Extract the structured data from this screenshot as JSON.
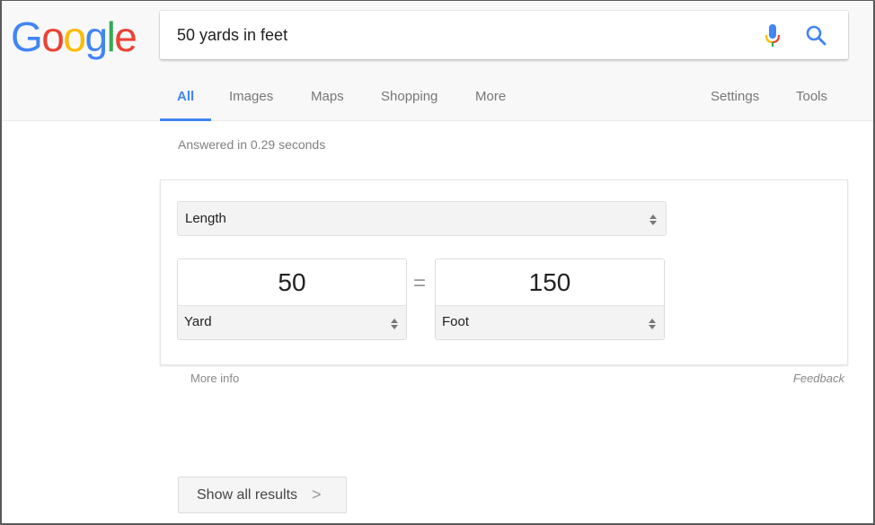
{
  "logo": {
    "text": "Google",
    "letters": [
      {
        "char": "G",
        "color": "#4285f4"
      },
      {
        "char": "o",
        "color": "#ea4335"
      },
      {
        "char": "o",
        "color": "#fbbc05"
      },
      {
        "char": "g",
        "color": "#4285f4"
      },
      {
        "char": "l",
        "color": "#34a853"
      },
      {
        "char": "e",
        "color": "#ea4335"
      }
    ]
  },
  "search": {
    "query": "50 yards in feet",
    "mic_icon": "microphone-icon",
    "search_icon": "magnifier-icon"
  },
  "tabs": {
    "items": [
      {
        "label": "All",
        "active": true
      },
      {
        "label": "Images",
        "active": false
      },
      {
        "label": "Maps",
        "active": false
      },
      {
        "label": "Shopping",
        "active": false
      },
      {
        "label": "More",
        "active": false
      }
    ],
    "settings_label": "Settings",
    "tools_label": "Tools"
  },
  "stats": "Answered in 0.29 seconds",
  "converter": {
    "category": "Length",
    "from": {
      "value": "50",
      "unit": "Yard"
    },
    "equals": "=",
    "to": {
      "value": "150",
      "unit": "Foot"
    }
  },
  "footer": {
    "more_info": "More info",
    "feedback": "Feedback"
  },
  "show_all": {
    "label": "Show all results",
    "chevron": ">"
  },
  "colors": {
    "accent": "#4285f4",
    "header_bg": "#f8f8f8",
    "select_bg": "#f3f3f3"
  }
}
